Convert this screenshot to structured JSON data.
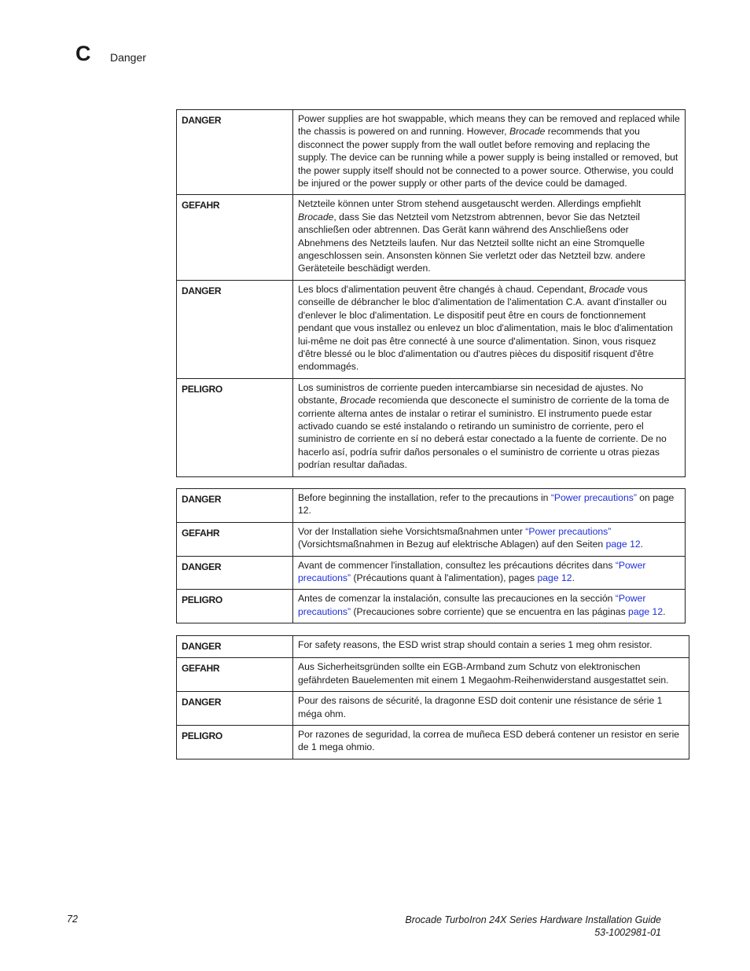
{
  "header": {
    "chapter_letter": "C",
    "section_title": "Danger"
  },
  "tables": [
    {
      "rows": [
        {
          "label": "DANGER",
          "text": [
            "Power supplies are hot swappable, which means they can be removed and replaced while the chassis is powered on and running. However, ",
            "Brocade",
            " recommends that you disconnect the power supply from the wall outlet before removing and replacing the supply. The device can be running while a power supply is being installed or removed, but the power supply itself should not be connected to a power source. Otherwise, you could be injured or the power supply or other parts of the device could be damaged."
          ]
        },
        {
          "label": "GEFAHR",
          "text": [
            "Netzteile können unter Strom stehend ausgetauscht werden. Allerdings empfiehlt ",
            "Brocade",
            ", dass Sie das Netzteil vom Netzstrom abtrennen, bevor Sie das Netzteil anschließen oder abtrennen. Das Gerät kann während des Anschließens oder Abnehmens des Netzteils laufen. Nur das Netzteil sollte nicht an eine Stromquelle angeschlossen sein. Ansonsten können Sie verletzt oder das Netzteil bzw. andere Geräteteile beschädigt werden."
          ]
        },
        {
          "label": "DANGER",
          "text": [
            "Les blocs d'alimentation peuvent être changés à chaud. Cependant, ",
            "Brocade",
            " vous conseille de débrancher le bloc d'alimentation de l'alimentation C.A. avant d'installer ou d'enlever le bloc d'alimentation. Le dispositif peut être en cours de fonctionnement pendant que vous installez ou enlevez un bloc d'alimentation, mais le bloc d'alimentation lui-même ne doit pas être connecté à une source d'alimentation. Sinon, vous risquez d'être blessé ou le bloc d'alimentation ou d'autres pièces du dispositif risquent d'être endommagés."
          ]
        },
        {
          "label": "PELIGRO",
          "text": [
            "Los suministros de corriente pueden intercambiarse sin necesidad de ajustes. No obstante, ",
            "Brocade",
            " recomienda que desconecte el suministro de corriente de la toma de corriente alterna antes de instalar o retirar el suministro. El instrumento puede estar activado cuando se esté instalando o retirando un suministro de corriente, pero el suministro de corriente en sí no deberá estar conectado a la fuente de corriente. De no hacerlo así, podría sufrir daños personales o el suministro de corriente u otras piezas podrían resultar dañadas."
          ]
        }
      ]
    },
    {
      "rows": [
        {
          "label": "DANGER",
          "before": "Before beginning the installation, refer to the precautions in ",
          "link1": "“Power precautions”",
          "middle": " on page 12.",
          "link2": "",
          "after": ""
        },
        {
          "label": "GEFAHR",
          "before": "Vor der Installation siehe Vorsichtsmaßnahmen unter ",
          "link1": "“Power precautions”",
          "middle": " (Vorsichtsmaßnahmen in Bezug auf elektrische Ablagen) auf den Seiten ",
          "link2": "page 12",
          "after": "."
        },
        {
          "label": "DANGER",
          "before": "Avant de commencer l'installation, consultez les précautions décrites dans ",
          "link1": "“Power precautions”",
          "middle": " (Précautions quant à l'alimentation), pages ",
          "link2": "page 12",
          "after": "."
        },
        {
          "label": "PELIGRO",
          "before": "Antes de comenzar la instalación, consulte las precauciones en la sección ",
          "link1": "“Power precautions”",
          "middle": " (Precauciones sobre corriente) que se encuentra en las páginas ",
          "link2": "page 12",
          "after": "."
        }
      ]
    },
    {
      "rows": [
        {
          "label": "DANGER",
          "text": "For safety reasons, the ESD wrist strap should contain a series 1 meg ohm resistor."
        },
        {
          "label": "GEFAHR",
          "text": "Aus Sicherheitsgründen sollte ein EGB-Armband zum Schutz von elektronischen gefährdeten Bauelementen mit einem 1 Megaohm-Reihenwiderstand ausgestattet sein."
        },
        {
          "label": "DANGER",
          "text": "Pour des raisons de sécurité, la dragonne ESD doit contenir une résistance de série 1 méga ohm."
        },
        {
          "label": "PELIGRO",
          "text": "Por razones de seguridad, la correa de muñeca ESD deberá contener un resistor en serie de 1 mega ohmio."
        }
      ]
    }
  ],
  "footer": {
    "page_number": "72",
    "guide_title": "Brocade TurboIron 24X Series Hardware Installation Guide",
    "doc_number": "53-1002981-01"
  },
  "colors": {
    "link": "#1f2fd6",
    "text": "#1a1a1a",
    "border": "#222222"
  }
}
